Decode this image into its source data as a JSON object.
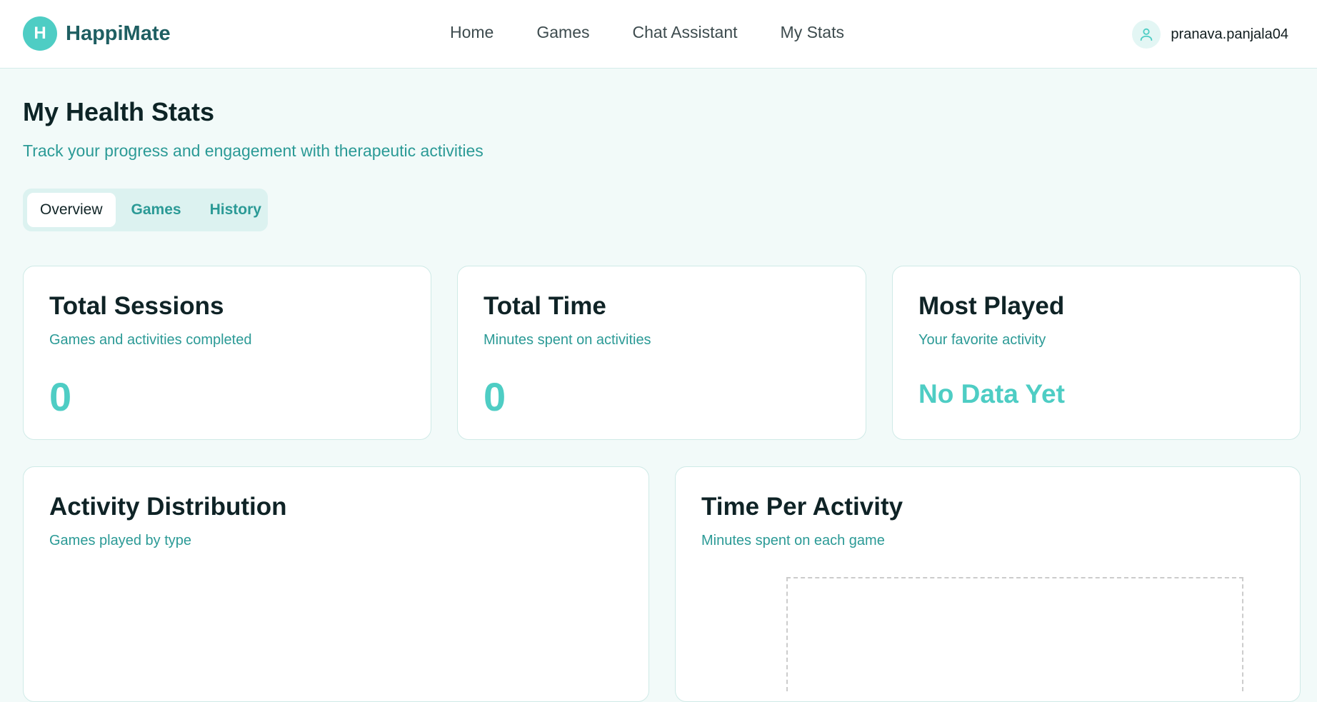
{
  "app": {
    "logo_letter": "H",
    "name": "HappiMate"
  },
  "nav": {
    "links": [
      "Home",
      "Games",
      "Chat Assistant",
      "My Stats"
    ]
  },
  "user": {
    "name": "pranava.panjala04",
    "icon": "user-icon"
  },
  "page": {
    "title": "My Health Stats",
    "subtitle": "Track your progress and engagement with therapeutic activities"
  },
  "tabs": [
    {
      "label": "Overview",
      "active": true
    },
    {
      "label": "Games",
      "active": false
    },
    {
      "label": "History",
      "active": false
    }
  ],
  "stats": [
    {
      "title": "Total Sessions",
      "subtitle": "Games and activities completed",
      "value": "0"
    },
    {
      "title": "Total Time",
      "subtitle": "Minutes spent on activities",
      "value": "0"
    },
    {
      "title": "Most Played",
      "subtitle": "Your favorite activity",
      "value": "No Data Yet"
    }
  ],
  "charts": [
    {
      "title": "Activity Distribution",
      "subtitle": "Games played by type"
    },
    {
      "title": "Time Per Activity",
      "subtitle": "Minutes spent on each game"
    }
  ],
  "colors": {
    "accent": "#4ecdc4",
    "brand_text": "#1f5f62",
    "secondary_text": "#2b9a96",
    "background": "#f2faf9"
  }
}
